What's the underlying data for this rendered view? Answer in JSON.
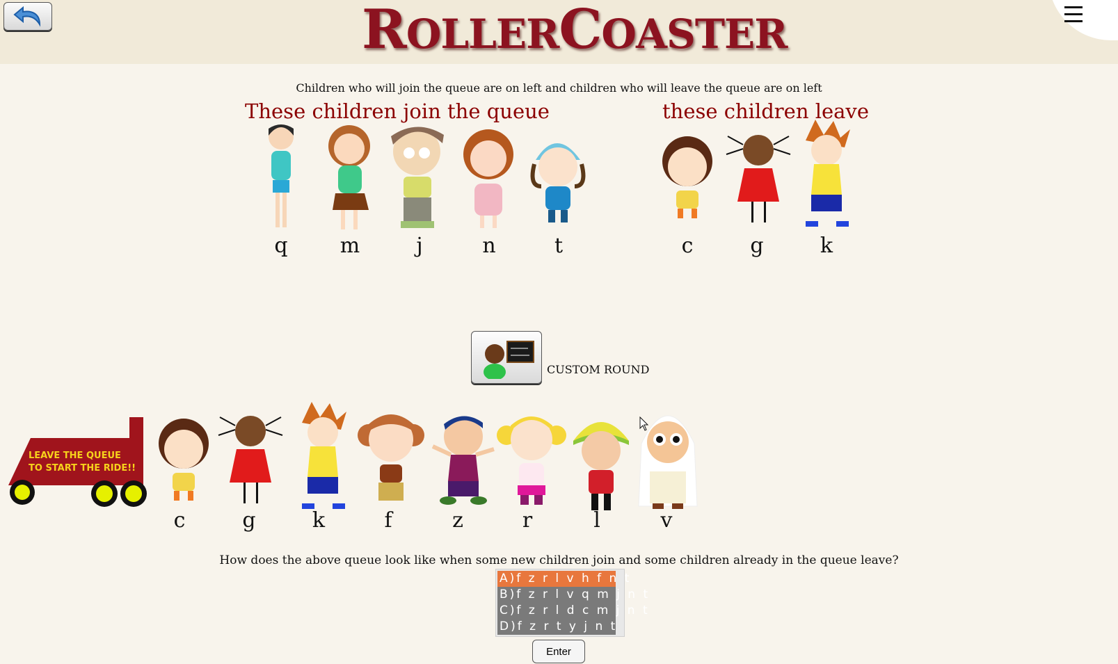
{
  "header": {
    "logo_text": "RollerCoaster",
    "logo_first": "R",
    "logo_mid": "OLLER",
    "logo_c": "C",
    "logo_rest": "OASTER"
  },
  "instruction": "Children who will join the queue are on left and children who will leave the queue are on left",
  "join_group": {
    "title": "These children join the queue",
    "kids": [
      "q",
      "m",
      "j",
      "n",
      "t"
    ]
  },
  "leave_group": {
    "title": "these children leave",
    "kids": [
      "c",
      "g",
      "k"
    ]
  },
  "custom_round": {
    "label": "CUSTOM ROUND"
  },
  "train": {
    "sign_line1": "LEAVE THE QUEUE",
    "sign_line2": "TO START THE RIDE!!"
  },
  "queue": {
    "kids": [
      "c",
      "g",
      "k",
      "f",
      "z",
      "r",
      "l",
      "v"
    ]
  },
  "question": "How does the above queue look like when some new children join and some children already in the queue leave?",
  "options": [
    {
      "label": "A)",
      "text": "f z r l v h f n t",
      "selected": true
    },
    {
      "label": "B)",
      "text": "f z r l v q m j n t",
      "selected": false
    },
    {
      "label": "C)",
      "text": "f z r l d c m j n t",
      "selected": false
    },
    {
      "label": "D)",
      "text": "f z r t y j n t",
      "selected": false
    }
  ],
  "enter_label": "Enter",
  "colors": {
    "title_red": "#8b0000",
    "selected_option": "#e8773d",
    "option_bg": "#7a7a7a",
    "train_red": "#a0141c",
    "wheel_yellow": "#e6f000"
  }
}
